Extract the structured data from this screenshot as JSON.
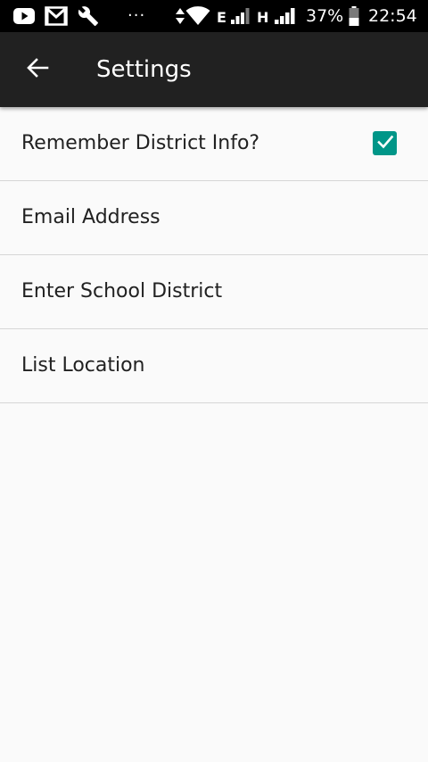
{
  "status_bar": {
    "time": "22:54",
    "battery_percent": "37%",
    "network_type_1": "E",
    "network_type_2": "H",
    "overflow_dots": "···",
    "icons": [
      "youtube-icon",
      "gmail-icon",
      "wrench-icon",
      "data-arrows-icon",
      "wifi-icon",
      "signal-icon",
      "signal-icon",
      "battery-icon"
    ]
  },
  "app_bar": {
    "title": "Settings",
    "back_icon": "arrow-back-icon"
  },
  "settings": {
    "items": [
      {
        "label": "Remember District Info?",
        "type": "checkbox",
        "checked": true
      },
      {
        "label": "Email Address",
        "type": "text"
      },
      {
        "label": "Enter School District",
        "type": "text"
      },
      {
        "label": "List Location",
        "type": "text"
      }
    ]
  },
  "colors": {
    "status_bar_bg": "#000000",
    "app_bar_bg": "#212121",
    "background": "#fafafa",
    "accent": "#009688",
    "divider": "#d6d6d6",
    "text_primary": "#212121"
  }
}
